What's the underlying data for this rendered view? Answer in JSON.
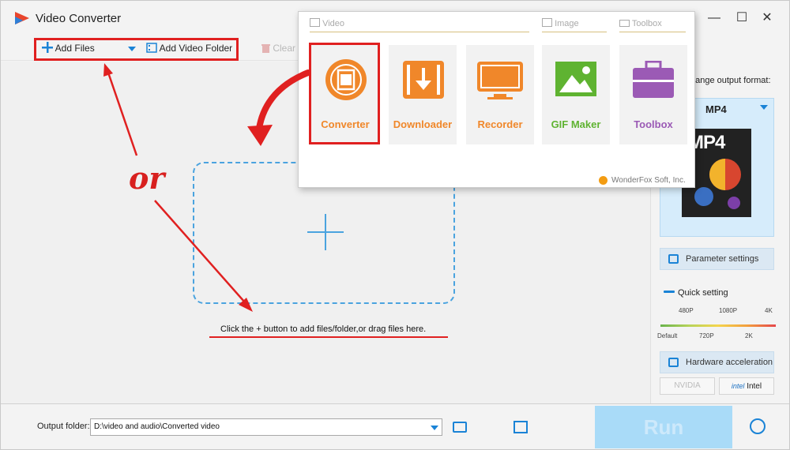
{
  "app": {
    "title": "Video Converter"
  },
  "window_controls": {
    "minimize": "—",
    "maximize": "☐",
    "close": "✕"
  },
  "toolbar": {
    "add_files": "Add Files",
    "add_video_folder": "Add Video Folder",
    "clear": "Clear"
  },
  "main": {
    "hint": "Click the + button to add files/folder,or drag files here.",
    "or_label": "or"
  },
  "popup": {
    "categories": {
      "video": "Video",
      "image": "Image",
      "toolbox": "Toolbox"
    },
    "tiles": [
      {
        "label": "Converter",
        "color": "#f0872a"
      },
      {
        "label": "Downloader",
        "color": "#f0872a"
      },
      {
        "label": "Recorder",
        "color": "#f0872a"
      },
      {
        "label": "GIF Maker",
        "color": "#5fb331"
      },
      {
        "label": "Toolbox",
        "color": "#9b5ab5"
      }
    ],
    "brand": "WonderFox Soft, Inc."
  },
  "right_panel": {
    "format_label": "hange output format:",
    "format": "MP4",
    "format_thumb": "MP4",
    "parameter_settings": "Parameter settings",
    "quick_setting": "Quick setting",
    "ticks_top": [
      "480P",
      "1080P",
      "4K"
    ],
    "ticks_bottom": [
      "Default",
      "720P",
      "2K"
    ],
    "hardware_acceleration": "Hardware acceleration",
    "gpu": {
      "nvidia": "NVIDIA",
      "intel": "Intel"
    }
  },
  "bottom": {
    "output_label": "Output folder:",
    "output_path": "D:\\video and audio\\Converted video",
    "run": "Run"
  },
  "colors": {
    "accent": "#1a83d6",
    "annotation": "#e02020",
    "run_bg": "#a9dbf8"
  }
}
